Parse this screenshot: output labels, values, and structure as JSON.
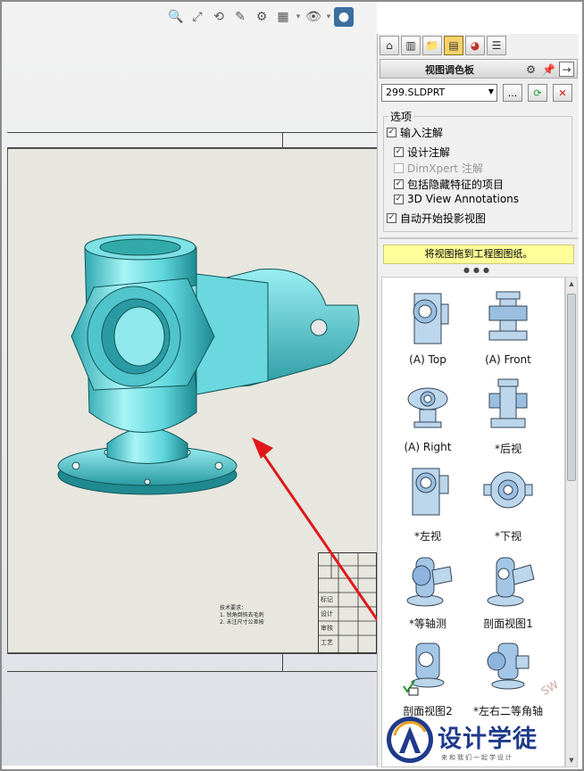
{
  "toolbar": {
    "icons": [
      "zoom-fit-icon",
      "zoom-area-icon",
      "previous-view-icon",
      "section-view-icon",
      "view-orientation-icon",
      "display-style-icon",
      "hide-show-icon",
      "appearance-icon"
    ]
  },
  "panel": {
    "title": "视图调色板",
    "tabs": [
      "home-icon",
      "part-icon",
      "folder-icon",
      "view-palette-icon",
      "appearance-icon",
      "properties-icon"
    ]
  },
  "file": {
    "selected": "299.SLDPRT",
    "browse_label": "..."
  },
  "options": {
    "group_label": "选项",
    "import_annotations": {
      "label": "输入注解",
      "checked": true
    },
    "design_annotations": {
      "label": "设计注解",
      "checked": true
    },
    "dimxpert_annotations": {
      "label": "DimXpert 注解",
      "checked": false,
      "disabled": true
    },
    "hidden_features": {
      "label": "包括隐藏特征的项目",
      "checked": true
    },
    "view_3d_annotations": {
      "label": "3D View Annotations",
      "checked": true
    },
    "auto_projection": {
      "label": "自动开始投影视图",
      "checked": true
    }
  },
  "drag_hint": "将视图拖到工程图图纸。",
  "views": [
    {
      "label": "(A) Top"
    },
    {
      "label": "(A) Front"
    },
    {
      "label": "(A) Right"
    },
    {
      "label": "*后视"
    },
    {
      "label": "*左视"
    },
    {
      "label": "*下视"
    },
    {
      "label": "*等轴测"
    },
    {
      "label": "剖面视图1"
    },
    {
      "label": "剖面视图2"
    },
    {
      "label": "*左右二等角轴"
    }
  ],
  "title_block": {
    "rows": [
      "标记",
      "设计",
      "审核",
      "工艺"
    ]
  },
  "notes": {
    "line1": "技术要求：",
    "line2": "1. 锐角倒钝去毛刺",
    "line3": "2. 未注尺寸公差按"
  },
  "logo": {
    "text": "设计学徒",
    "sub": "来和我们一起学设计",
    "watermark": "SW"
  },
  "colors": {
    "part": "#5fd6dc",
    "accent": "#1f3a8a",
    "hint": "#ffff99"
  }
}
